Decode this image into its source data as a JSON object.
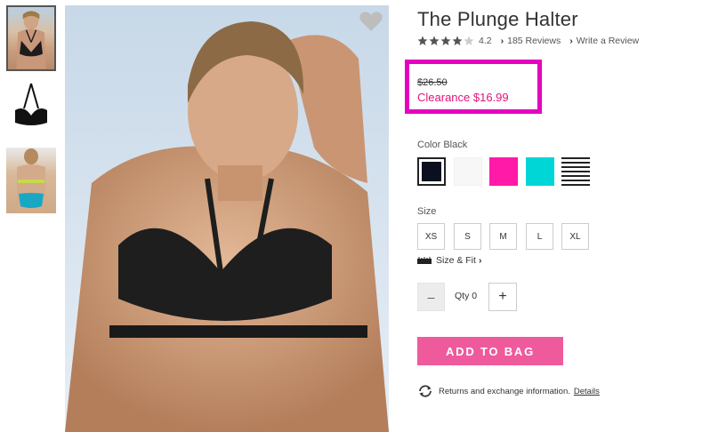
{
  "product": {
    "title": "The Plunge Halter",
    "rating": "4.2",
    "stars_filled": 4,
    "stars_total": 5,
    "reviews_link": "185 Reviews",
    "write_review_link": "Write a Review",
    "price_original": "$26.50",
    "price_clearance": "Clearance $16.99"
  },
  "color": {
    "label": "Color Black",
    "swatches": [
      "black",
      "white",
      "pink",
      "cyan",
      "striped"
    ],
    "selected": "black"
  },
  "size": {
    "label": "Size",
    "options": [
      "XS",
      "S",
      "M",
      "L",
      "XL"
    ],
    "size_fit_link": "Size & Fit"
  },
  "quantity": {
    "minus": "–",
    "label": "Qty 0",
    "plus": "+"
  },
  "actions": {
    "add_to_bag": "ADD TO BAG"
  },
  "returns": {
    "text": "Returns and exchange information.",
    "details_link": "Details"
  },
  "icons": {
    "favorite": "heart-icon",
    "ruler": "ruler-icon",
    "exchange": "refresh-icon",
    "rating": "star-icon",
    "link": "chevron-right-icon"
  },
  "colors": {
    "accent_pink": "#ef5a9c",
    "clearance_red": "#e0147a",
    "highlight_magenta": "#e600c0"
  }
}
